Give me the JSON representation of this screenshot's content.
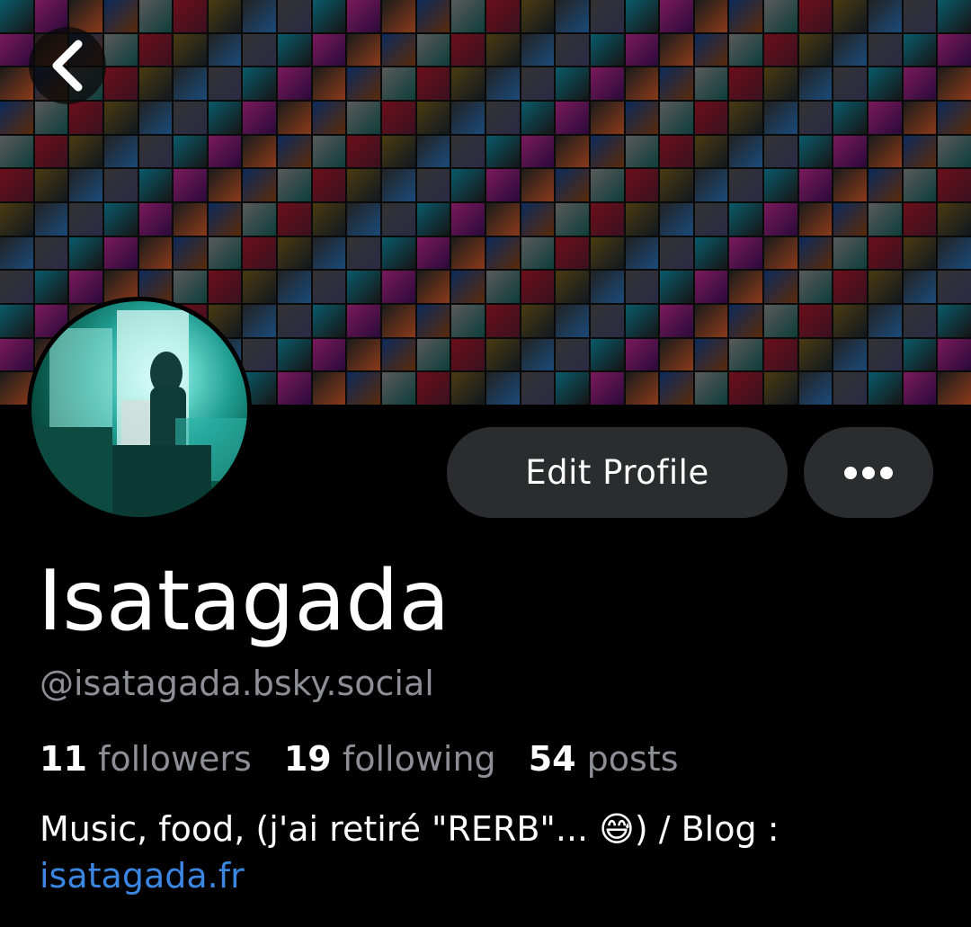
{
  "header": {
    "back_icon": "chevron-left-icon"
  },
  "actions": {
    "edit_profile_label": "Edit Profile",
    "more_icon": "ellipsis-icon"
  },
  "profile": {
    "display_name": "Isatagada",
    "handle": "@isatagada.bsky.social",
    "stats": [
      {
        "count": "11",
        "label": "followers"
      },
      {
        "count": "19",
        "label": "following"
      },
      {
        "count": "54",
        "label": "posts"
      }
    ],
    "bio_text": "Music, food, (j'ai retiré \"RERB\"... 😅) / Blog : ",
    "bio_link": "isatagada.fr"
  },
  "colors": {
    "background": "#000000",
    "button_bg": "#2b2c2e",
    "muted_text": "#8c8f96",
    "link": "#3a86e0"
  }
}
